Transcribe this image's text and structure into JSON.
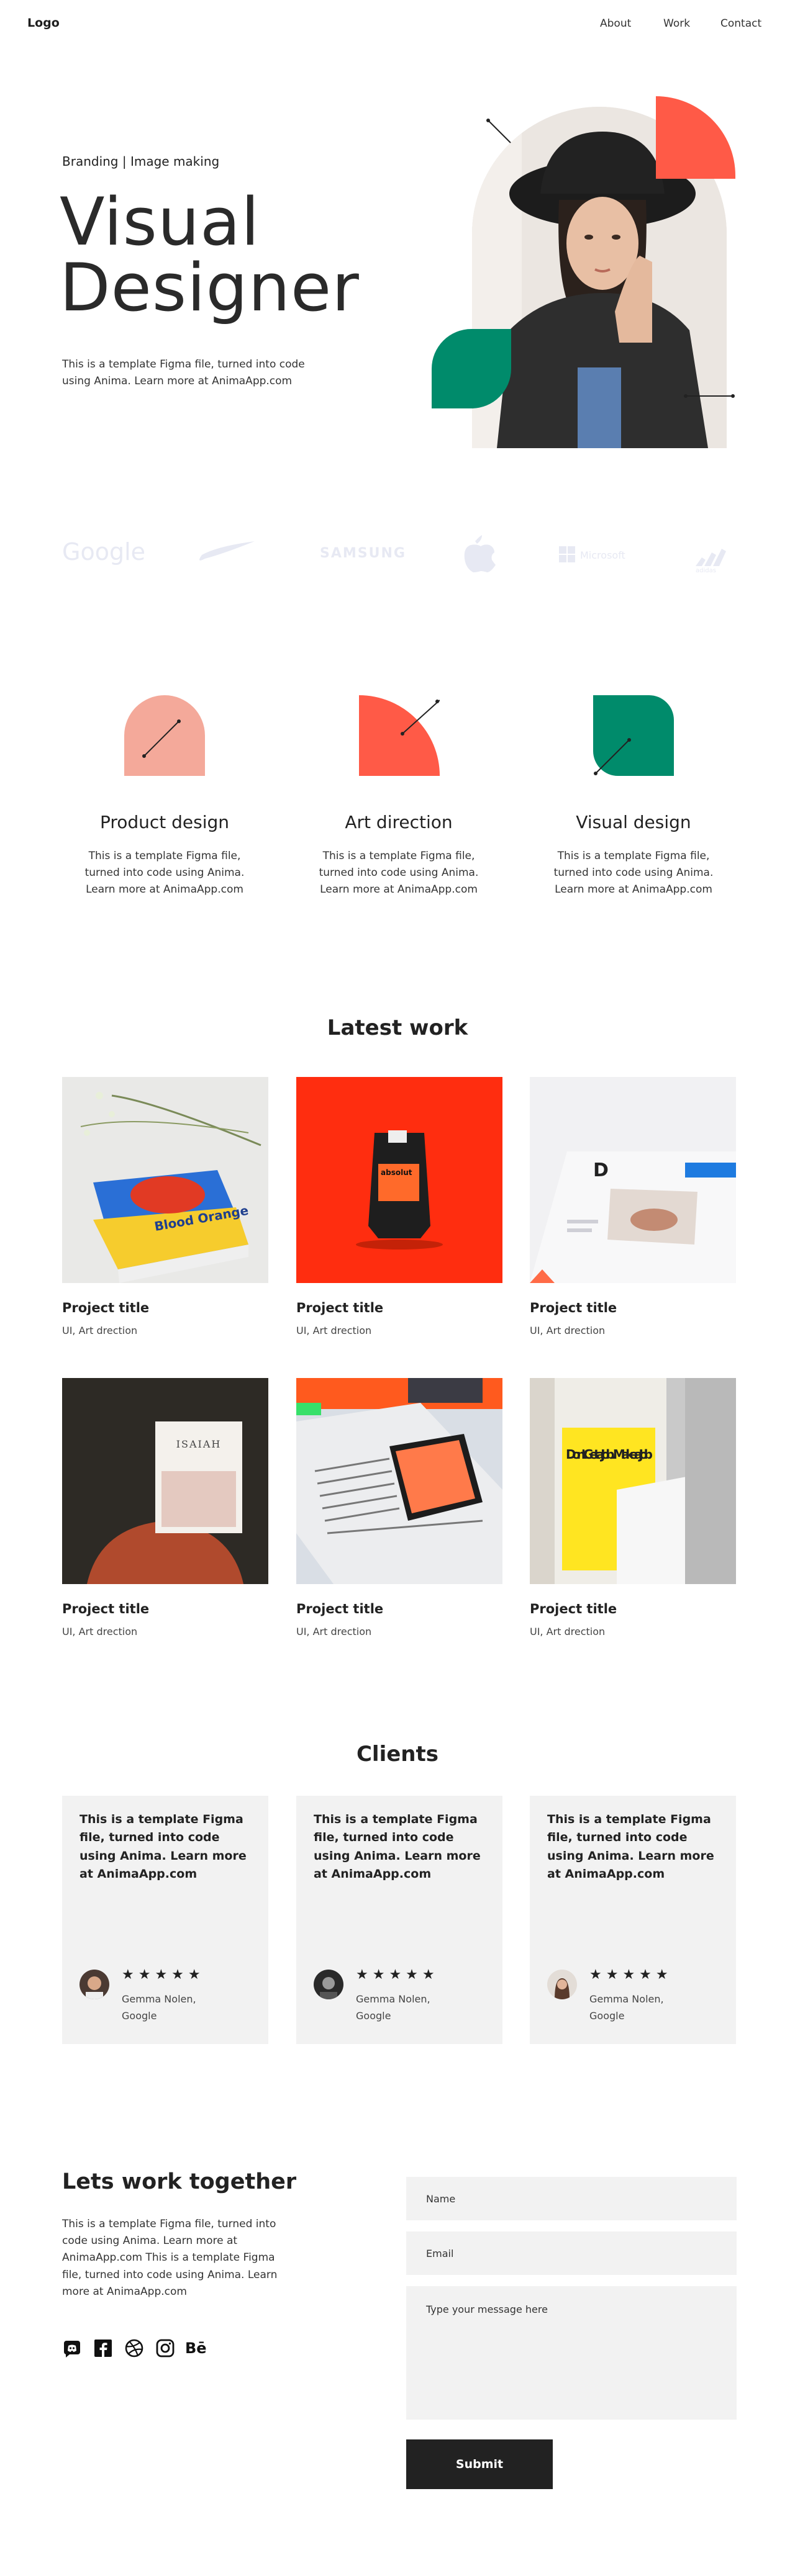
{
  "nav": {
    "logo": "Logo",
    "links": [
      "About",
      "Work",
      "Contact"
    ]
  },
  "hero": {
    "kicker": "Branding | Image making",
    "title_line1": "Visual",
    "title_line2": "Designer",
    "description": "This is a template Figma file, turned into code using Anima. Learn more at AnimaApp.com"
  },
  "brands": [
    "Google",
    "Nike",
    "Samsung",
    "Apple",
    "Microsoft",
    "Adidas"
  ],
  "services": [
    {
      "title": "Product design",
      "description": "This is a template Figma file, turned into code using Anima. Learn more at AnimaApp.com"
    },
    {
      "title": "Art direction",
      "description": "This is a template Figma file, turned into code using Anima. Learn more at AnimaApp.com"
    },
    {
      "title": "Visual design",
      "description": "This is a template Figma file, turned into code using Anima. Learn more at AnimaApp.com"
    }
  ],
  "work": {
    "title": "Latest work",
    "items": [
      {
        "title": "Project title",
        "tags": "UI, Art drection",
        "image_text": "Blood Orange"
      },
      {
        "title": "Project title",
        "tags": "UI, Art drection",
        "image_text": "absolut"
      },
      {
        "title": "Project title",
        "tags": "UI, Art drection",
        "image_text": "D"
      },
      {
        "title": "Project title",
        "tags": "UI, Art drection",
        "image_text": "ISAIAH"
      },
      {
        "title": "Project title",
        "tags": "UI, Art drection",
        "image_text": ""
      },
      {
        "title": "Project title",
        "tags": "UI, Art drection",
        "image_text": "Don't Get a Job... Make a Job"
      }
    ]
  },
  "clients": {
    "title": "Clients",
    "items": [
      {
        "quote": "This is a template Figma file, turned into code using Anima. Learn more at AnimaApp.com",
        "stars": "★★★★★",
        "name": "Gemma Nolen,",
        "company": "Google"
      },
      {
        "quote": "This is a template Figma file, turned into code using Anima. Learn more at AnimaApp.com",
        "stars": "★★★★★",
        "name": "Gemma Nolen,",
        "company": "Google"
      },
      {
        "quote": "This is a template Figma file, turned into code using Anima. Learn more at AnimaApp.com",
        "stars": "★★★★★",
        "name": "Gemma Nolen,",
        "company": "Google"
      }
    ]
  },
  "contact": {
    "title": "Lets work together",
    "description": "This is a template Figma file, turned into code using Anima. Learn more at AnimaApp.com This is a template Figma file, turned into code using Anima. Learn more at AnimaApp.com",
    "social_icons": [
      "discord-icon",
      "facebook-icon",
      "dribbble-icon",
      "instagram-icon",
      "behance-icon"
    ],
    "behance_label": "Bē",
    "name_placeholder": "Name",
    "email_placeholder": "Email",
    "message_placeholder": "Type your message here",
    "submit_label": "Submit"
  },
  "colors": {
    "accent_red": "#ff5a47",
    "accent_green": "#008b6b",
    "accent_pink": "#f4a99a",
    "dark": "#222222",
    "card_bg": "#f2f2f2"
  }
}
